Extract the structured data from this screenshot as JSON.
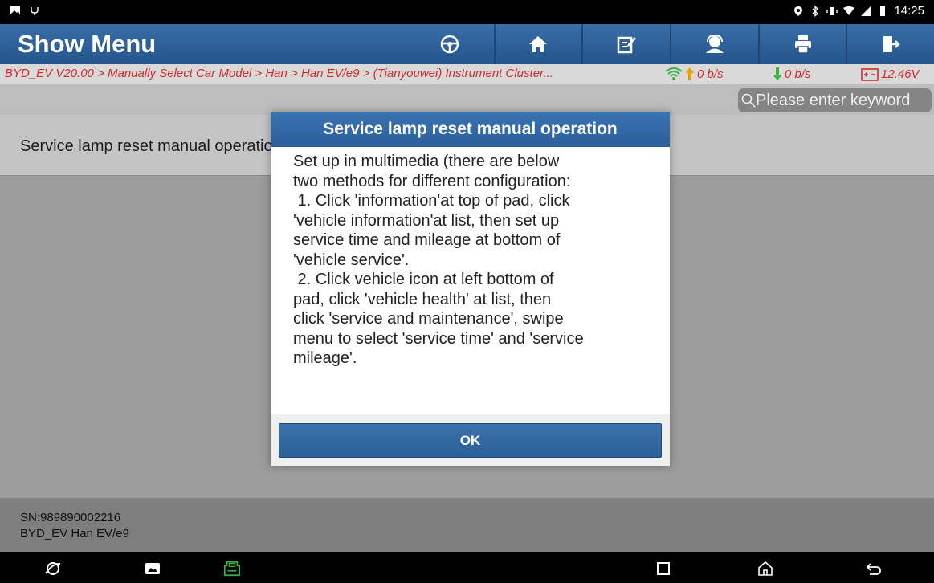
{
  "status_bar": {
    "time": "14:25"
  },
  "header": {
    "title": "Show Menu",
    "toolbar": [
      "steering-wheel-icon",
      "home-icon",
      "edit-report-icon",
      "support-icon",
      "print-icon",
      "exit-icon"
    ]
  },
  "breadcrumb": {
    "path": "BYD_EV V20.00 > Manually Select Car Model > Han > Han EV/e9 > (Tianyouwei) Instrument Cluster...",
    "upload_speed": "0 b/s",
    "download_speed": "0 b/s",
    "battery_voltage": "12.46V"
  },
  "search": {
    "placeholder": "Please enter keyword"
  },
  "list": {
    "items": [
      {
        "label": "Service lamp reset manual operation"
      }
    ]
  },
  "footer": {
    "sn": "SN:989890002216",
    "model": "BYD_EV Han EV/e9"
  },
  "dialog": {
    "title": "Service lamp reset manual operation",
    "lines": [
      "Set up in multimedia (there are below",
      "two methods for different configuration:",
      " 1. Click 'information'at top of pad, click",
      "'vehicle information'at list, then set up",
      "service time and mileage at bottom of",
      "'vehicle service'.",
      " 2. Click vehicle icon at left bottom of",
      "pad, click 'vehicle health' at list, then",
      "click 'service and maintenance', swipe",
      "menu to select 'service time' and 'service",
      "mileage'."
    ],
    "ok_label": "OK"
  },
  "colors": {
    "accent": "#2b5f9c",
    "breadcrumb_text": "#d42a2a",
    "vci_green": "#3cb043"
  }
}
